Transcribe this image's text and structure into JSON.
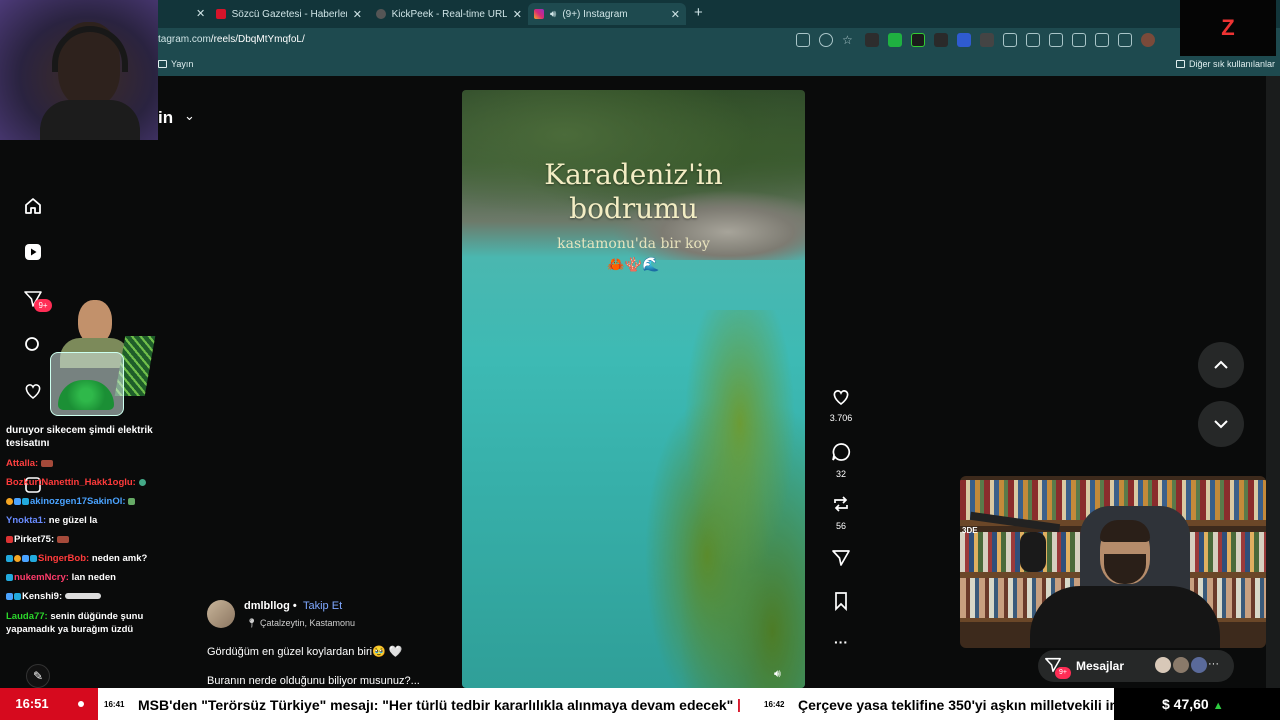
{
  "browser": {
    "tabs": [
      {
        "label": "Sözcü Gazetesi - Haberler, son da",
        "icon_color": "#d6142a"
      },
      {
        "label": "KickPeek - Real-time URL Crawler",
        "icon_color": "#555555"
      },
      {
        "label": "(9+) Instagram",
        "icon_color": "#d62976"
      }
    ],
    "url_prefix": "tagram.com",
    "url_path": "/reels/DbqMtYmqfoL/",
    "bookmarks_left": "Yayın",
    "bookmarks_right": "Diğer sık kullanılanlar"
  },
  "instagram": {
    "account_title": "in",
    "notification_badge": "9+",
    "reel": {
      "title_line1": "Karadeniz'in",
      "title_line2": "bodrumu",
      "subtitle": "kastamonu'da bir koy",
      "emoji": "🦀🪸🌊"
    },
    "actions": {
      "likes": "3.706",
      "comments": "32",
      "reposts": "56"
    },
    "post": {
      "username": "dmlbllog",
      "separator": "•",
      "follow": "Takip Et",
      "location": "Çatalzeytin, Kastamonu",
      "caption1": "Gördüğüm en güzel koylardan biri🥹 🤍",
      "caption2": "Buranın nerde olduğunu biliyor musunuz?..."
    },
    "messages": {
      "label": "Mesajlar",
      "badge": "9+"
    }
  },
  "chat": {
    "first_message": "duruyor sikecem şimdi elektrik tesisatını",
    "lines": [
      {
        "user": "Attalla:",
        "user_color": "#ff4040",
        "text": ""
      },
      {
        "user": "BozkurtNanettin_Hakk1oglu:",
        "user_color": "#ff3b3b",
        "text": ""
      },
      {
        "user": "akinozgen17SakinOl:",
        "user_color": "#4aa3ff",
        "text": ""
      },
      {
        "user": "Ynokta1:",
        "user_color": "#6a8cff",
        "text": "ne güzel la"
      },
      {
        "user": "Pirket75:",
        "user_color": "#ffffff",
        "text": ""
      },
      {
        "user": "SingerBob:",
        "user_color": "#ff3b3b",
        "text": "neden amk?"
      },
      {
        "user": "nukemNcry:",
        "user_color": "#ff3b6b",
        "text": "lan neden"
      },
      {
        "user": "Kenshi9:",
        "user_color": "#ffffff",
        "text": ""
      },
      {
        "user": "Lauda77:",
        "user_color": "#2bd62b",
        "text": "senin düğünde şunu yapamadık ya burağım üzdü"
      }
    ]
  },
  "ticker": {
    "time": "16:51",
    "item1_time": "16:41",
    "item1_text": "MSB'den \"Terörsüz Türkiye\" mesajı: \"Her türlü tedbir kararlılıkla alınmaya devam edecek\"",
    "separator": "|",
    "item2_time": "16:42",
    "item2_text": "Çerçeve yasa teklifine 350'yi aşkın milletvekili im",
    "price": "$ 47,60",
    "price_arrow": "▲"
  },
  "stream": {
    "logo": "Z",
    "cam_tag": "3DE"
  }
}
